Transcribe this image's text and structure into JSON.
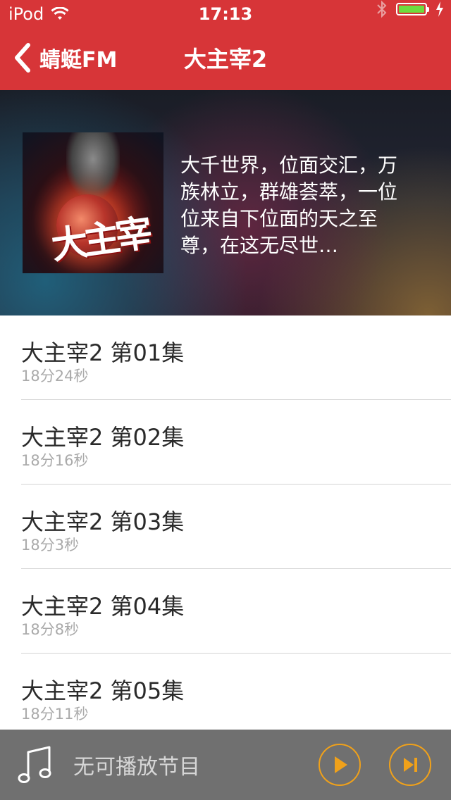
{
  "status": {
    "carrier": "iPod",
    "time": "17:13"
  },
  "nav": {
    "back_label": "蜻蜓FM",
    "title": "大主宰2"
  },
  "hero": {
    "cover_logo": "大主宰",
    "description": "大千世界，位面交汇，万族林立，群雄荟萃，一位位来自下位面的天之至尊，在这无尽世…"
  },
  "episodes": [
    {
      "title": "大主宰2 第01集",
      "duration": "18分24秒"
    },
    {
      "title": "大主宰2 第02集",
      "duration": "18分16秒"
    },
    {
      "title": "大主宰2 第03集",
      "duration": "18分3秒"
    },
    {
      "title": "大主宰2 第04集",
      "duration": "18分8秒"
    },
    {
      "title": "大主宰2 第05集",
      "duration": "18分11秒"
    }
  ],
  "player": {
    "status_text": "无可播放节目"
  },
  "colors": {
    "header": "#d73538",
    "accent": "#f0a11a",
    "player_bg": "#707070",
    "battery": "#6ddc3e"
  },
  "icons": [
    "wifi-icon",
    "bluetooth-icon",
    "battery-icon",
    "charging-icon",
    "chevron-left-icon",
    "music-note-icon",
    "play-icon",
    "next-icon"
  ]
}
